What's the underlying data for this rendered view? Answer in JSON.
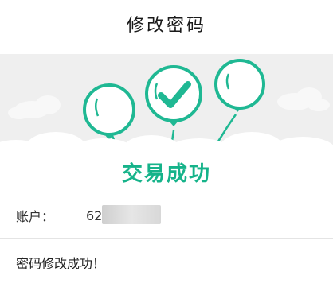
{
  "header": {
    "title": "修改密码"
  },
  "status": {
    "result_text": "交易成功",
    "icon": "check-icon",
    "accent_color": "#16b38a"
  },
  "account": {
    "label": "账户：",
    "value_prefix": "62"
  },
  "message": "密码修改成功！"
}
